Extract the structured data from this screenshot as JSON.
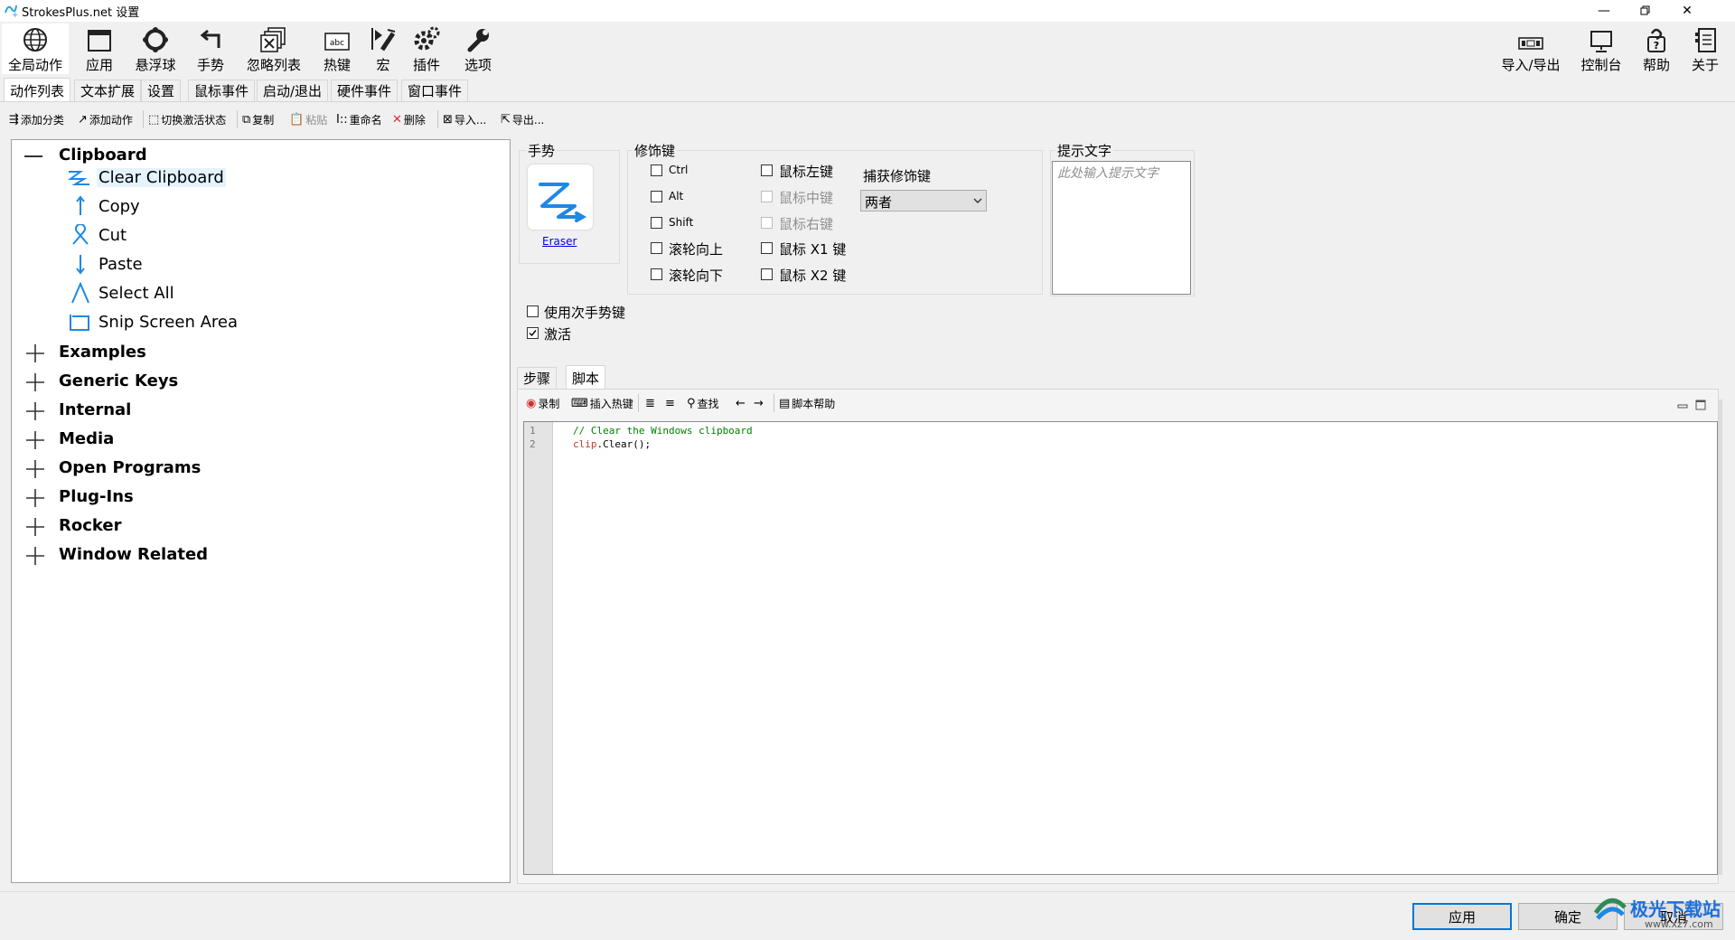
{
  "window": {
    "title": "StrokesPlus.net 设置",
    "minimize_icon": "minimize-icon",
    "restore_icon": "restore-icon",
    "close_icon": "close-icon"
  },
  "toolbar": {
    "left": [
      {
        "label": "全局动作",
        "icon": "globe-icon"
      },
      {
        "label": "应用",
        "icon": "window-icon"
      },
      {
        "label": "悬浮球",
        "icon": "ring-icon"
      },
      {
        "label": "手势",
        "icon": "gesture-icon"
      },
      {
        "label": "忽略列表",
        "icon": "ignore-list-icon"
      },
      {
        "label": "热键",
        "icon": "hotkey-icon"
      },
      {
        "label": "宏",
        "icon": "macro-icon"
      },
      {
        "label": "插件",
        "icon": "plugin-icon"
      },
      {
        "label": "选项",
        "icon": "wrench-icon"
      }
    ],
    "right": [
      {
        "label": "导入/导出",
        "icon": "import-export-icon"
      },
      {
        "label": "控制台",
        "icon": "console-icon"
      },
      {
        "label": "帮助",
        "icon": "help-icon"
      },
      {
        "label": "关于",
        "icon": "about-icon"
      }
    ]
  },
  "tabs": [
    "动作列表",
    "文本扩展",
    "设置",
    "鼠标事件",
    "启动/退出",
    "硬件事件",
    "窗口事件"
  ],
  "actions": {
    "add_category": "添加分类",
    "add_action": "添加动作",
    "toggle_active": "切换激活状态",
    "copy": "复制",
    "paste": "粘贴",
    "rename": "重命名",
    "delete": "删除",
    "import": "导入...",
    "export": "导出..."
  },
  "tree": {
    "expanded_category": "Clipboard",
    "items": [
      "Clear Clipboard",
      "Copy",
      "Cut",
      "Paste",
      "Select All",
      "Snip Screen Area"
    ],
    "categories": [
      "Examples",
      "Generic Keys",
      "Internal",
      "Media",
      "Open Programs",
      "Plug-Ins",
      "Rocker",
      "Window Related"
    ]
  },
  "gesture": {
    "label": "手势",
    "name": "Eraser"
  },
  "modifiers": {
    "label": "修饰键",
    "col1": [
      "Ctrl",
      "Alt",
      "Shift",
      "滚轮向上",
      "滚轮向下"
    ],
    "col2": [
      "鼠标左键",
      "鼠标中键",
      "鼠标右键",
      "鼠标 X1 键",
      "鼠标 X2 键"
    ],
    "capture_label": "捕获修饰键",
    "capture_value": "两者"
  },
  "hint": {
    "label": "提示文字",
    "placeholder": "此处输入提示文字"
  },
  "options": {
    "use_secondary": "使用次手势键",
    "active": "激活"
  },
  "script_tabs": [
    "步骤",
    "脚本"
  ],
  "script_toolbar": {
    "record": "录制",
    "insert_hotkey": "插入热键",
    "find": "查找",
    "script_help": "脚本帮助"
  },
  "editor": {
    "line1_no": "1",
    "line2_no": "2",
    "line1": "// Clear the Windows clipboard",
    "line2_obj": "clip",
    "line2_rest": ".Clear();"
  },
  "footer": {
    "apply": "应用",
    "ok": "确定",
    "cancel": "取消",
    "watermark": "极光下载站",
    "watermark_url": "www.xz7.com"
  },
  "colors": {
    "accent": "#0078d7",
    "comment": "#008000",
    "icon_blue": "#1e88e5"
  }
}
